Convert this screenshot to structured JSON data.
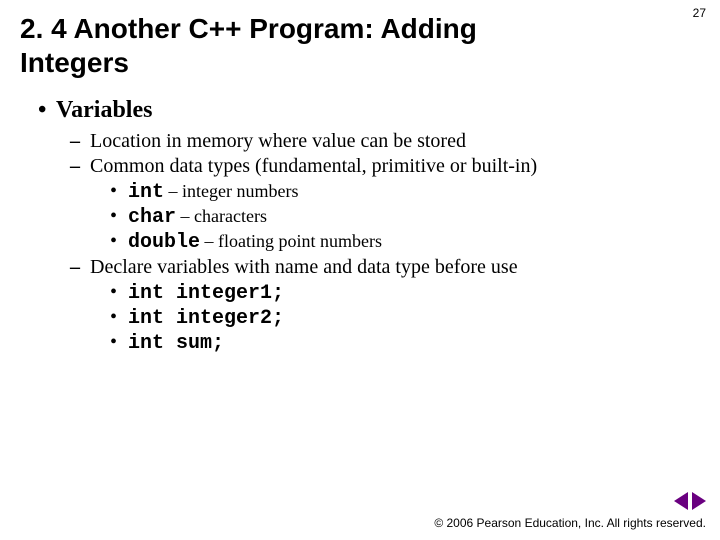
{
  "page_number": "27",
  "title": "2. 4 Another C++ Program: Adding Integers",
  "content": {
    "heading": "Variables",
    "sub1": "Location in memory where value can be stored",
    "sub2": "Common data types (fundamental, primitive or built-in)",
    "type_int_code": "int",
    "type_int_desc": " – integer numbers",
    "type_char_code": "char",
    "type_char_desc": " – characters",
    "type_double_code": "double",
    "type_double_desc": " – floating point numbers",
    "sub3": "Declare variables with name and data type before use",
    "decl1": "int integer1;",
    "decl2": "int integer2;",
    "decl3": "int sum;"
  },
  "footer": "© 2006 Pearson Education, Inc.  All rights reserved."
}
